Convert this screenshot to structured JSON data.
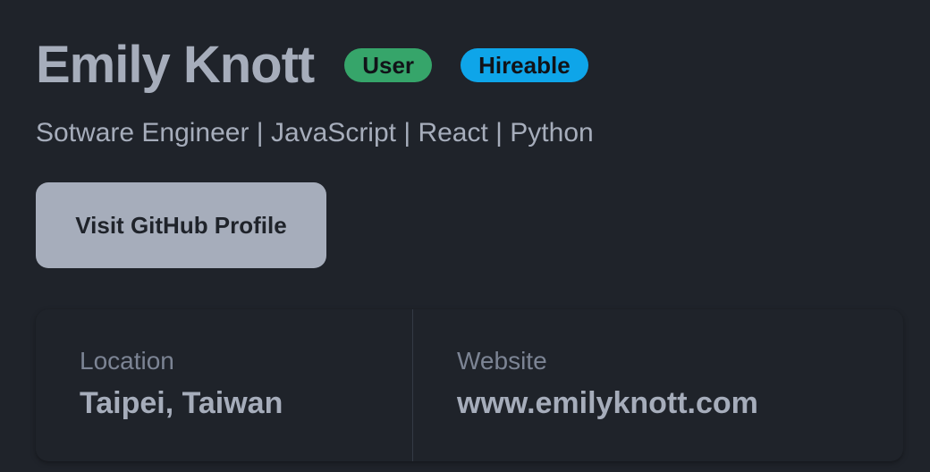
{
  "profile": {
    "name": "Emily Knott",
    "badges": {
      "user": "User",
      "hireable": "Hireable"
    },
    "bio": "Sotware Engineer | JavaScript | React | Python",
    "github_button_label": "Visit GitHub Profile"
  },
  "stats": {
    "location": {
      "title": "Location",
      "value": "Taipei, Taiwan"
    },
    "website": {
      "title": "Website",
      "value": "www.emilyknott.com"
    }
  },
  "colors": {
    "background": "#1f232a",
    "text": "#a6adbb",
    "badge_user": "#36a56a",
    "badge_hireable": "#0ea5e9",
    "button": "#a6adbb"
  }
}
